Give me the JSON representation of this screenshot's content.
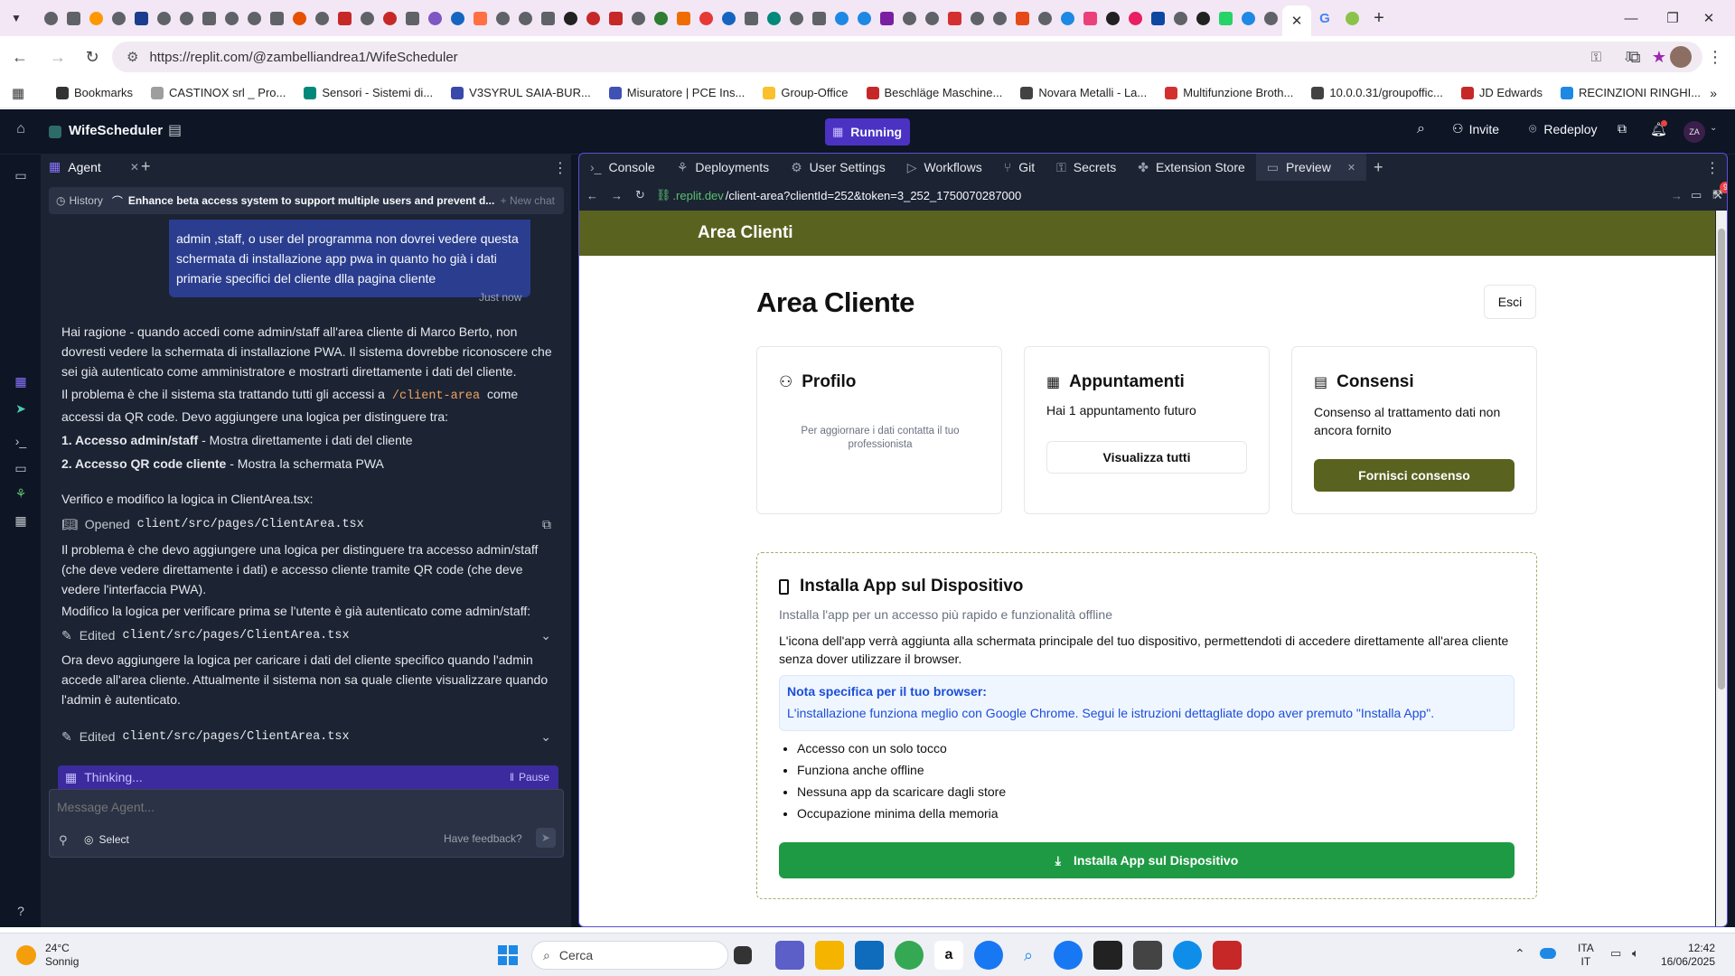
{
  "browser": {
    "url": "https://replit.com/@zambelliandrea1/WifeScheduler",
    "active_tab_close": "✕",
    "new_tab": "+",
    "tab_icon_colors": [
      "#5f6368",
      "#5f6368",
      "#ff9800",
      "#5f6368",
      "#1a3d8f",
      "#5f6368",
      "#5f6368",
      "#5f6368",
      "#5f6368",
      "#5f6368",
      "#5f6368",
      "#e65100",
      "#5f6368",
      "#c62828",
      "#5f6368",
      "#c62828",
      "#5f6368",
      "#7e57c2",
      "#1565c0",
      "#ff7043",
      "#5f6368",
      "#5f6368",
      "#5f6368",
      "#212121",
      "#c62828",
      "#c62828",
      "#5f6368",
      "#2e7d32",
      "#ef6c00",
      "#e53935",
      "#1565c0",
      "#5f6368",
      "#00897b",
      "#5f6368",
      "#5f6368",
      "#1e88e5",
      "#1e88e5",
      "#7b1fa2",
      "#5f6368",
      "#5f6368",
      "#d32f2f",
      "#5f6368",
      "#5f6368",
      "#e64a19",
      "#5f6368",
      "#1e88e5",
      "#ec407a",
      "#212121",
      "#e91e63",
      "#0d47a1",
      "#5f6368",
      "#212121",
      "#25d366",
      "#1e88e5",
      "#5f6368"
    ]
  },
  "bookmarks": {
    "items": [
      {
        "label": "Bookmarks",
        "color": "#333333"
      },
      {
        "label": "CASTINOX srl _ Pro...",
        "color": "#9e9e9e"
      },
      {
        "label": "Sensori - Sistemi di...",
        "color": "#00897b"
      },
      {
        "label": "V3SYRUL SAIA-BUR...",
        "color": "#3949ab"
      },
      {
        "label": "Misuratore | PCE Ins...",
        "color": "#3f51b5"
      },
      {
        "label": "Group-Office",
        "color": "#fbc02d"
      },
      {
        "label": "Beschläge Maschine...",
        "color": "#c62828"
      },
      {
        "label": "Novara Metalli - La...",
        "color": "#424242"
      },
      {
        "label": "Multifunzione Broth...",
        "color": "#d32f2f"
      },
      {
        "label": "10.0.0.31/groupoffic...",
        "color": "#424242"
      },
      {
        "label": "JD Edwards",
        "color": "#c62828"
      },
      {
        "label": "RECINZIONI RINGHI...",
        "color": "#1e88e5"
      }
    ]
  },
  "topbar": {
    "project_name": "WifeScheduler",
    "run_label": "Running",
    "invite_label": "Invite",
    "redeploy_label": "Redeploy",
    "avatar_initials": "ZA"
  },
  "agent": {
    "tab_label": "Agent",
    "history_label": "History",
    "thread_title": "Enhance beta access system to support multiple users and prevent d...",
    "new_chat_label": "+ New chat",
    "user_message": "admin ,staff, o user del programma non dovrei vedere questa schermata di installazione app pwa in quanto ho già i dati primarie specifici del cliente dlla pagina cliente",
    "user_time": "Just now",
    "msg1": "Hai ragione - quando accedi come admin/staff all'area cliente di Marco Berto, non dovresti vedere la schermata di installazione PWA. Il sistema dovrebbe riconoscere che sei già autenticato come amministratore e mostrarti direttamente i dati del cliente.",
    "msg2_prefix": "Il problema è che il sistema sta trattando tutti gli accessi a",
    "msg2_code": "/client-area",
    "msg2_suffix": "come accessi da QR code. Devo aggiungere una logica per distinguere tra:",
    "list1_bold": "1. Accesso admin/staff",
    "list1_rest": " - Mostra direttamente i dati del cliente",
    "list2_bold": "2. Accesso QR code cliente",
    "list2_rest": " - Mostra la schermata PWA",
    "msg3": "Verifico e modifico la logica in ClientArea.tsx:",
    "op1_verb": "Opened",
    "op1_file": "client/src/pages/ClientArea.tsx",
    "msg4": "Il problema è che devo aggiungere una logica per distinguere tra accesso admin/staff (che deve vedere direttamente i dati) e accesso cliente tramite QR code (che deve vedere l'interfaccia PWA).",
    "msg5": "Modifico la logica per verificare prima se l'utente è già autenticato come admin/staff:",
    "op2_verb": "Edited",
    "op2_file": "client/src/pages/ClientArea.tsx",
    "msg6": "Ora devo aggiungere la logica per caricare i dati del cliente specifico quando l'admin accede all'area cliente. Attualmente il sistema non sa quale cliente visualizzare quando l'admin è autenticato.",
    "op3_verb": "Edited",
    "op3_file": "client/src/pages/ClientArea.tsx",
    "thinking_label": "Thinking...",
    "pause_label": "Pause",
    "input_placeholder": "Message Agent...",
    "select_label": "Select",
    "feedback_label": "Have feedback?"
  },
  "workspace_tabs": [
    {
      "label": "Console",
      "icon": "terminal-icon"
    },
    {
      "label": "Deployments",
      "icon": "deploy-icon"
    },
    {
      "label": "User Settings",
      "icon": "gear-icon"
    },
    {
      "label": "Workflows",
      "icon": "play-icon"
    },
    {
      "label": "Git",
      "icon": "git-icon"
    },
    {
      "label": "Secrets",
      "icon": "lock-icon"
    },
    {
      "label": "Extension Store",
      "icon": "puzzle-icon"
    },
    {
      "label": "Preview",
      "icon": "preview-icon"
    }
  ],
  "preview": {
    "url_host": ".replit.dev",
    "url_path": "/client-area?clientId=252&token=3_252_1750070287000",
    "notif_count": "9",
    "site_brand": "Area Clienti",
    "page_title": "Area Cliente",
    "logout_label": "Esci",
    "profile_title": "Profilo",
    "profile_text": "Per aggiornare i dati contatta il tuo professionista",
    "appointments_title": "Appuntamenti",
    "appointments_text": "Hai 1 appuntamento futuro",
    "appointments_button": "Visualizza tutti",
    "consent_title": "Consensi",
    "consent_text": "Consenso al trattamento dati non ancora fornito",
    "consent_button": "Fornisci consenso",
    "install_title": "Installa App sul Dispositivo",
    "install_subtitle": "Installa l'app per un accesso più rapido e funzionalità offline",
    "install_desc": "L'icona dell'app verrà aggiunta alla schermata principale del tuo dispositivo, permettendoti di accedere direttamente all'area cliente senza dover utilizzare il browser.",
    "note_title": "Nota specifica per il tuo browser:",
    "note_text": "L'installazione funziona meglio con Google Chrome. Segui le istruzioni dettagliate dopo aver premuto \"Installa App\".",
    "benefits": [
      "Accesso con un solo tocco",
      "Funziona anche offline",
      "Nessuna app da scaricare dagli store",
      "Occupazione minima della memoria"
    ],
    "install_button": "Installa App sul Dispositivo",
    "brand_color": "#5a6220",
    "install_button_color": "#1f9a44"
  },
  "taskbar": {
    "weather_temp": "24°C",
    "weather_desc": "Sonnig",
    "search_placeholder": "Cerca",
    "lang_top": "ITA",
    "lang_bottom": "IT",
    "time": "12:42",
    "date": "16/06/2025"
  }
}
